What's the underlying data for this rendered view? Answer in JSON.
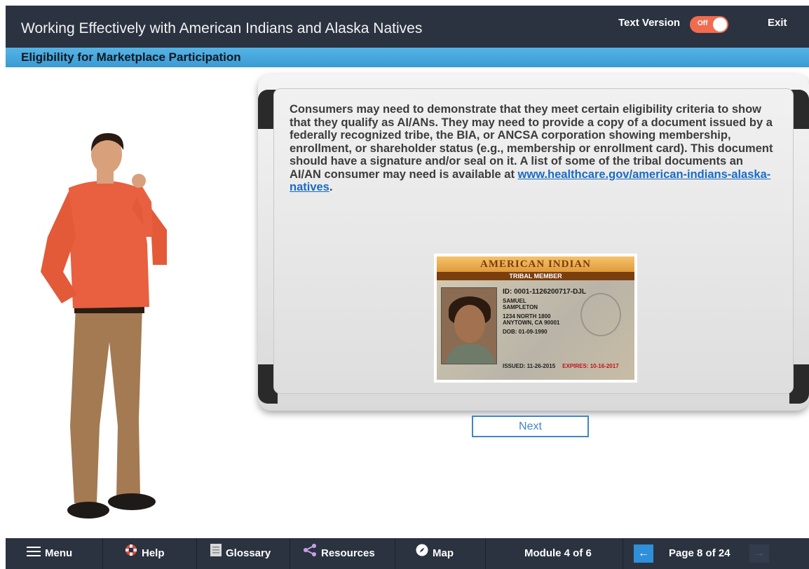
{
  "header": {
    "title": "Working Effectively with American Indians and Alaska Natives",
    "text_version_label": "Text Version",
    "toggle_state": "Off",
    "exit_label": "Exit"
  },
  "section": {
    "title": "Eligibility for Marketplace Participation"
  },
  "content": {
    "paragraph": "Consumers may need to demonstrate that they meet certain eligibility criteria to show that they qualify as AI/ANs. They may need to provide a copy of a document issued by a federally recognized tribe, the BIA, or ANCSA corporation showing membership, enrollment, or shareholder status (e.g., membership or enrollment card). This document should have a signature and/or seal on it. A list of some of the tribal documents an AI/AN consumer may need is available at ",
    "link_text": "www.healthcare.gov/american-indians-alaska-natives",
    "after_link": "."
  },
  "id_card": {
    "banner": "AMERICAN INDIAN",
    "subtitle": "TRIBAL MEMBER",
    "id_line": "ID: 0001-1126200717-DJL",
    "name_1": "SAMUEL",
    "name_2": "SAMPLETON",
    "address_1": "1234 NORTH 1800",
    "address_2": "ANYTOWN, CA 90001",
    "dob": "DOB: 01-09-1990",
    "issued": "ISSUED: 11-26-2015",
    "expired": "EXPIRES: 10-16-2017"
  },
  "next_button": "Next",
  "footer": {
    "menu": "Menu",
    "help": "Help",
    "glossary": "Glossary",
    "resources": "Resources",
    "map": "Map",
    "module": "Module 4 of 6",
    "page": "Page 8 of 24"
  },
  "colors": {
    "header_bg": "#2b3341",
    "section_bar": "#3a9ad3",
    "toggle": "#f26b4f",
    "link": "#1a6bc5",
    "accent_button": "#2f8fd8"
  }
}
